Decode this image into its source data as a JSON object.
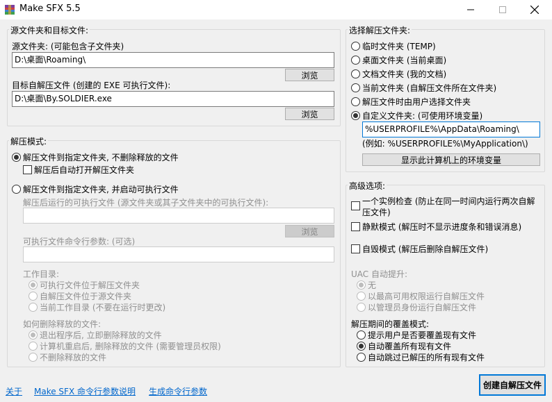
{
  "window": {
    "title": "Make SFX 5.5"
  },
  "source_group": {
    "title": "源文件夹和目标文件:",
    "source_label": "源文件夹: (可能包含子文件夹)",
    "source_value": "D:\\桌面\\Roaming\\",
    "browse1": "浏览",
    "target_label": "目标自解压文件 (创建的 EXE 可执行文件):",
    "target_value": "D:\\桌面\\By.SOLDIER.exe",
    "browse2": "浏览"
  },
  "extract_mode": {
    "title": "解压模式:",
    "option1": "解压文件到指定文件夹, 不删除释放的文件",
    "auto_open": "解压后自动打开解压文件夹",
    "option2": "解压文件到指定文件夹, 并启动可执行文件",
    "exe_label": "解压后运行的可执行文件 (源文件夹或其子文件夹中的可执行文件):",
    "exe_value": "",
    "browse3": "浏览",
    "params_label": "可执行文件命令行参数: (可选)",
    "params_value": "",
    "workdir_label": "工作目录:",
    "workdir_options": [
      "可执行文件位于解压文件夹",
      "自解压文件位于源文件夹",
      "当前工作目录 (不要在运行时更改)"
    ],
    "delete_label": "如何删除释放的文件:",
    "delete_options": [
      "退出程序后, 立即删除释放的文件",
      "计算机重启后, 删除释放的文件 (需要管理员权限)",
      "不删除释放的文件"
    ]
  },
  "folder_group": {
    "title": "选择解压文件夹:",
    "options": [
      "临时文件夹 (TEMP)",
      "桌面文件夹 (当前桌面)",
      "文档文件夹 (我的文档)",
      "当前文件夹 (自解压文件所在文件夹)",
      "解压文件时由用户选择文件夹",
      "自定义文件夹: (可使用环境变量)"
    ],
    "custom_value": "%USERPROFILE%\\AppData\\Roaming\\",
    "example": "(例如: %USERPROFILE%\\MyApplication\\)",
    "env_button": "显示此计算机上的环境变量"
  },
  "advanced": {
    "title": "高级选项:",
    "single_instance_line1": "一个实例检查 (防止在同一时间内运行两次自解",
    "single_instance_line2": "压文件)",
    "silent": "静默模式 (解压时不显示进度条和错误消息)",
    "self_delete": "自毁模式 (解压后删除自解压文件)",
    "uac_label": "UAC 自动提升:",
    "uac_options": [
      "无",
      "以最高可用权限运行自解压文件",
      "以管理员身份运行自解压文件"
    ],
    "overwrite_label": "解压期间的覆盖模式:",
    "overwrite_options": [
      "提示用户是否要覆盖现有文件",
      "自动覆盖所有现有文件",
      "自动跳过已解压的所有现有文件"
    ]
  },
  "footer": {
    "about": "关于",
    "cmd_help": "Make SFX 命令行参数说明",
    "gen_cmd": "生成命令行参数",
    "create_button": "创建自解压文件"
  }
}
